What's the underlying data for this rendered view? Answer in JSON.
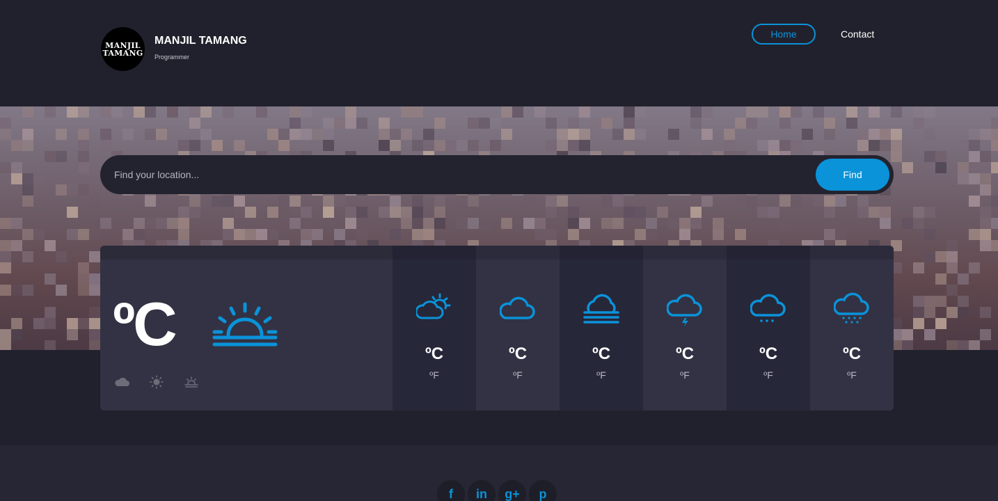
{
  "header": {
    "logo_text_line1": "MANJIL",
    "logo_text_line2": "TAMANG",
    "name": "MANJIL TAMANG",
    "subtitle": "Programmer",
    "nav": {
      "home": "Home",
      "contact": "Contact"
    }
  },
  "search": {
    "placeholder": "Find your location...",
    "button": "Find"
  },
  "today": {
    "temp": "ºC",
    "icon": "sunrise-icon",
    "mini_icons": [
      "cloud-icon",
      "sun-icon",
      "sunrise-icon"
    ]
  },
  "forecast": [
    {
      "icon": "partly-cloudy-icon",
      "tc": "ºC",
      "tf": "ºF"
    },
    {
      "icon": "cloud-icon",
      "tc": "ºC",
      "tf": "ºF"
    },
    {
      "icon": "fog-icon",
      "tc": "ºC",
      "tf": "ºF"
    },
    {
      "icon": "thunderstorm-icon",
      "tc": "ºC",
      "tf": "ºF"
    },
    {
      "icon": "snow-icon",
      "tc": "ºC",
      "tf": "ºF"
    },
    {
      "icon": "heavy-snow-icon",
      "tc": "ºC",
      "tf": "ºF"
    }
  ],
  "social": [
    {
      "icon": "facebook-icon",
      "glyph": "f"
    },
    {
      "icon": "linkedin-icon",
      "glyph": "in"
    },
    {
      "icon": "google-plus-icon",
      "glyph": "g+"
    },
    {
      "icon": "pinterest-icon",
      "glyph": "p"
    }
  ],
  "colors": {
    "accent": "#0a93d9",
    "background": "#21212d",
    "card": "#323244"
  }
}
